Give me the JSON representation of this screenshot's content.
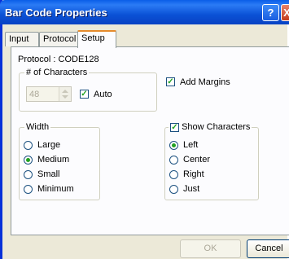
{
  "window": {
    "title": "Bar Code Properties",
    "help_label": "?",
    "close_label": "X"
  },
  "tabs": [
    {
      "label": "Input"
    },
    {
      "label": "Protocol"
    },
    {
      "label": "Setup"
    }
  ],
  "setup": {
    "protocol_text": "Protocol : CODE128",
    "chars_group": "# of Characters",
    "chars_value": "48",
    "auto_label": "Auto",
    "auto_checked": true,
    "add_margins_label": "Add Margins",
    "add_margins_checked": true,
    "width_group": "Width",
    "width_options": [
      "Large",
      "Medium",
      "Small",
      "Minimum"
    ],
    "width_selected": "Medium",
    "show_chars_label": "Show Characters",
    "show_chars_checked": true,
    "align_options": [
      "Left",
      "Center",
      "Right",
      "Just"
    ],
    "align_selected": "Left"
  },
  "footer": {
    "ok_label": "OK",
    "cancel_label": "Cancel"
  },
  "colors": {
    "title_bar": "#0a5ee8",
    "tab_highlight": "#e68b2c",
    "check": "#21a121"
  }
}
